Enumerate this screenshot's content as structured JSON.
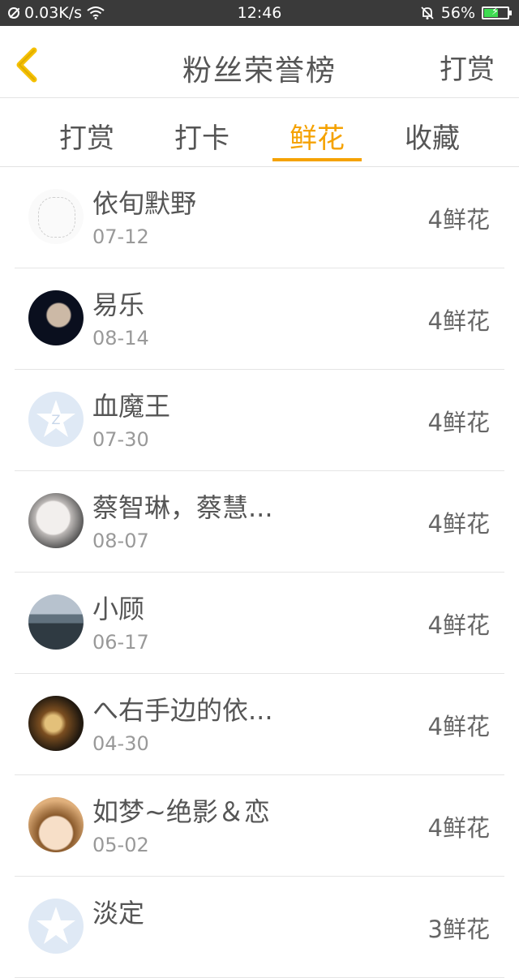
{
  "status_bar": {
    "net_speed": "0.03K/s",
    "time": "12:46",
    "battery": "56%",
    "battery_level": 0.56
  },
  "header": {
    "title": "粉丝荣誉榜",
    "action": "打赏",
    "back_icon": "chevron-left-icon"
  },
  "tabs": [
    {
      "label": "打赏",
      "active": false
    },
    {
      "label": "打卡",
      "active": false
    },
    {
      "label": "鲜花",
      "active": true
    },
    {
      "label": "收藏",
      "active": false
    }
  ],
  "list": [
    {
      "name": "依旬默野",
      "date": "07-12",
      "amount": "4鲜花"
    },
    {
      "name": "易乐",
      "date": "08-14",
      "amount": "4鲜花"
    },
    {
      "name": "血魔王",
      "date": "07-30",
      "amount": "4鲜花"
    },
    {
      "name": "蔡智琳，蔡慧...",
      "date": "08-07",
      "amount": "4鲜花"
    },
    {
      "name": "小顾",
      "date": "06-17",
      "amount": "4鲜花"
    },
    {
      "name": "へ右手边的依...",
      "date": "04-30",
      "amount": "4鲜花"
    },
    {
      "name": "如梦~绝影＆恋",
      "date": "05-02",
      "amount": "4鲜花"
    },
    {
      "name": "淡定",
      "date": "",
      "amount": "3鲜花"
    }
  ],
  "colors": {
    "accent": "#f5a200",
    "status_bar": "#3a3a3a",
    "text": "#555555",
    "subtext": "#999999"
  }
}
